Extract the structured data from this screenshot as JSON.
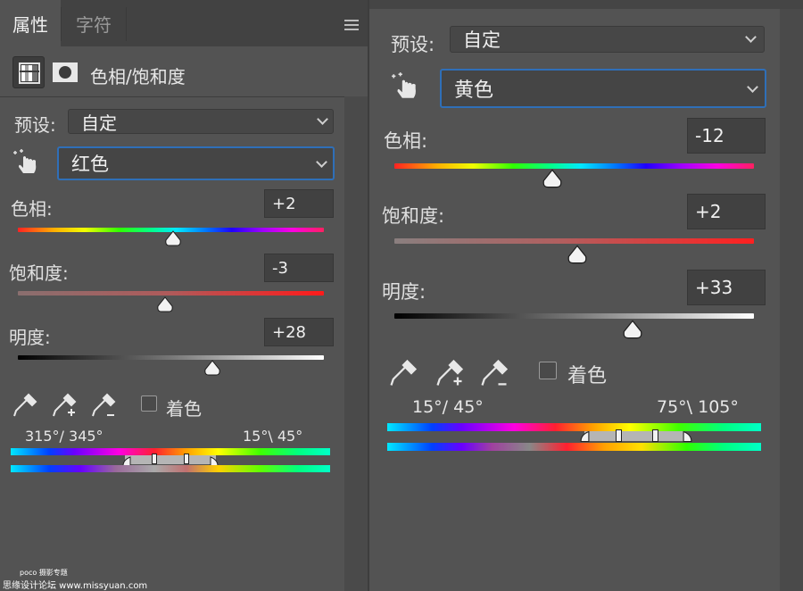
{
  "left": {
    "tabs": [
      {
        "label": "属性"
      },
      {
        "label": "字符"
      }
    ],
    "panel_title": "色相/饱和度",
    "preset_label": "预设:",
    "preset_value": "自定",
    "channel_value": "红色",
    "hue": {
      "label": "色相:",
      "value": "+2",
      "level": 0.505
    },
    "saturation": {
      "label": "饱和度:",
      "value": "-3",
      "level": 0.485
    },
    "lightness": {
      "label": "明度:",
      "value": "+28",
      "level": 0.64
    },
    "colorize_label": "着色",
    "range_left": "315°/ 345°",
    "range_right": "15°\\ 45°"
  },
  "right": {
    "preset_label": "预设:",
    "preset_value": "自定",
    "channel_value": "黄色",
    "hue": {
      "label": "色相:",
      "value": "-12",
      "level": 0.44
    },
    "saturation": {
      "label": "饱和度:",
      "value": "+2",
      "level": 0.505
    },
    "lightness": {
      "label": "明度:",
      "value": "+33",
      "level": 0.665
    },
    "colorize_label": "着色",
    "range_left": "15°/ 45°",
    "range_right": "75°\\ 105°"
  },
  "watermark": {
    "line1": "poco 摄影专题",
    "line2": "思缘设计论坛 www.missyuan.com"
  },
  "icons": [
    "menu-icon",
    "adjustment-layer-icon",
    "mask-icon",
    "targeted-adjustment-hand-icon",
    "eyedropper-icon",
    "eyedropper-add-icon",
    "eyedropper-subtract-icon",
    "chevron-down-icon",
    "slider-thumb-icon"
  ],
  "colors": {
    "panel_bg": "#535353",
    "tabbar_bg": "#424242",
    "focus_border": "#2f6fb8",
    "field_bg": "#414141"
  }
}
